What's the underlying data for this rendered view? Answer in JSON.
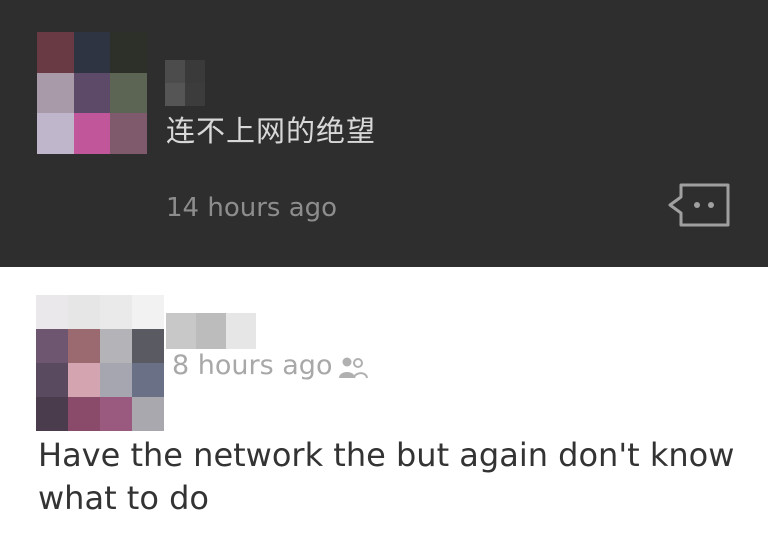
{
  "posts": [
    {
      "status": "连不上网的绝望",
      "time": "14 hours ago",
      "icons": {
        "comment": "comment-bubble-icon"
      },
      "avatar_colors": [
        "#6a3a44",
        "#2f3442",
        "#2c3028",
        "#a89aa8",
        "#5c4a68",
        "#5c6454",
        "#c0b6cc",
        "#c2569a",
        "#7e5a6c"
      ],
      "name_colors": [
        "#4c4c4c",
        "#3a3a3a",
        "#2e2e2e",
        "#555555",
        "#3c3c3c",
        "#2e2e2e"
      ]
    },
    {
      "time": "8 hours ago",
      "text": "Have the network the but again don't know what to do",
      "icons": {
        "audience": "friends-icon"
      },
      "avatar_colors": [
        "#eae8ea",
        "#e6e6e6",
        "#eaeaea",
        "#f2f2f2",
        "#6e5670",
        "#9a6a70",
        "#b4b4b8",
        "#5a5a62",
        "#5a4a60",
        "#d4a4b0",
        "#a6a6b0",
        "#6a7086",
        "#4a3c4c",
        "#8a4a6a",
        "#9a5a80",
        "#a8a8ae"
      ],
      "name_colors": [
        "#c8c8c8",
        "#bcbcbc",
        "#e6e6e6"
      ]
    }
  ]
}
